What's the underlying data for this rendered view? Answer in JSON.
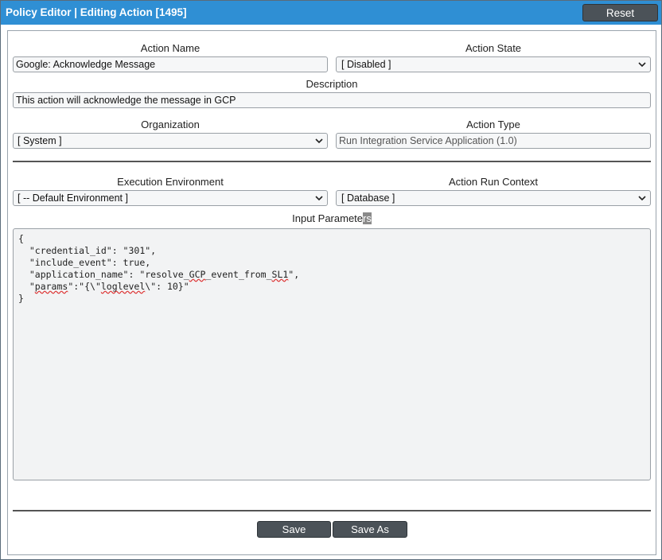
{
  "window": {
    "title": "Policy Editor | Editing Action [1495]",
    "reset_label": "Reset"
  },
  "form": {
    "action_name": {
      "label": "Action Name",
      "value": "Google: Acknowledge Message"
    },
    "action_state": {
      "label": "Action State",
      "value": "[ Disabled ]"
    },
    "description": {
      "label": "Description",
      "value": "This action will acknowledge the message in GCP"
    },
    "organization": {
      "label": "Organization",
      "value": "[ System ]"
    },
    "action_type": {
      "label": "Action Type",
      "value": "Run Integration Service Application (1.0)"
    },
    "execution_environment": {
      "label": "Execution Environment",
      "value": "[ -- Default Environment ]"
    },
    "action_run_context": {
      "label": "Action Run Context",
      "value": "[ Database ]"
    },
    "input_parameters": {
      "label_main": "Input Paramete",
      "label_selected": "rs",
      "lines": [
        "{",
        "  \"credential_id\": \"301\",",
        "  \"include_event\": true,",
        "  \"application_name\": \"resolve_GCP_event_from_SL1\",",
        "  \"params\":\"{\\\"loglevel\\\": 10}\"",
        "}"
      ]
    }
  },
  "footer": {
    "save_label": "Save",
    "save_as_label": "Save As"
  },
  "colors": {
    "titlebar": "#2f8fd4",
    "button": "#4b5258",
    "field_bg": "#f6f7f8"
  }
}
